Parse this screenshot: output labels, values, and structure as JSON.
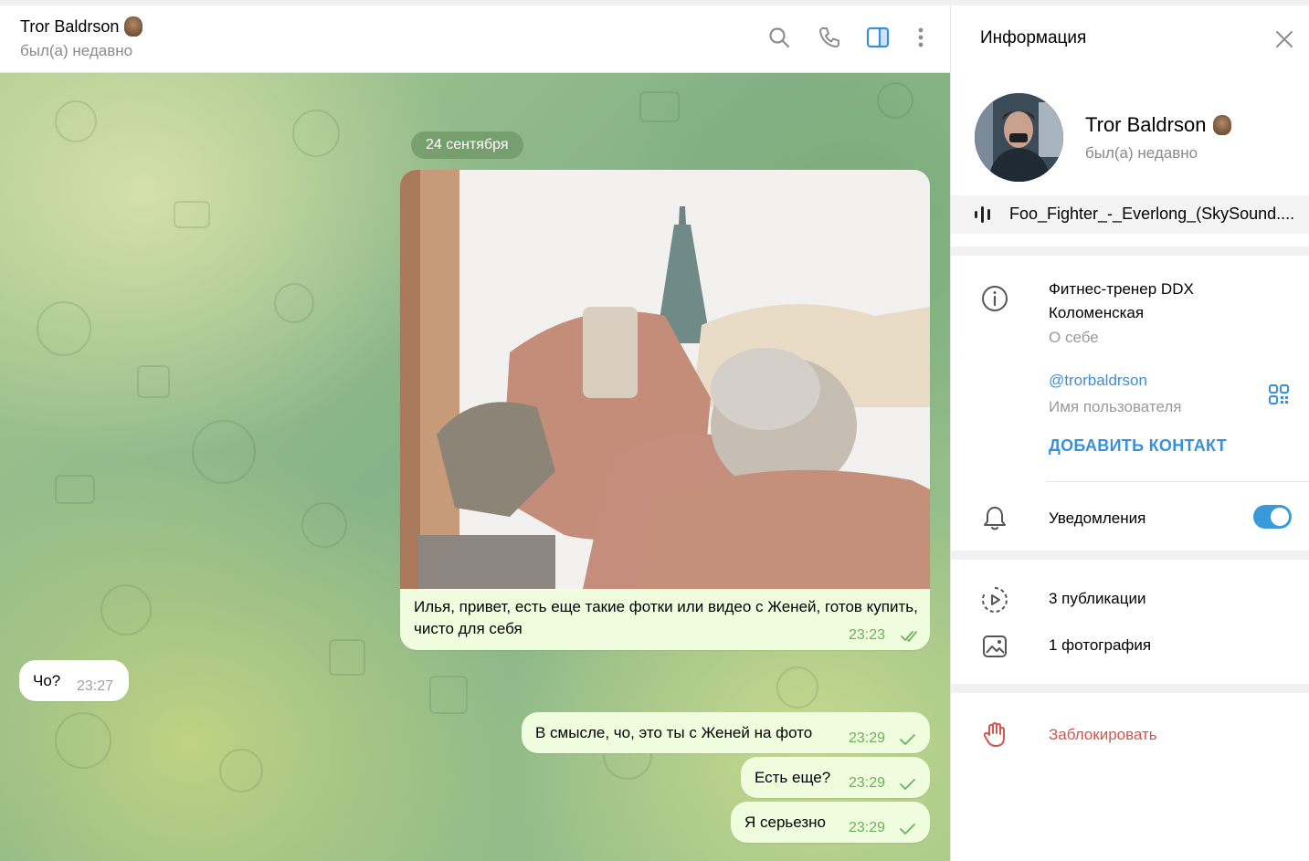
{
  "chat": {
    "title": "Tror Baldrson",
    "status": "был(а) недавно",
    "header_icons": [
      "search-icon",
      "phone-icon",
      "sidebar-toggle-icon",
      "more-vertical-icon"
    ],
    "date_separator": "24 сентября",
    "messages": [
      {
        "type": "photo",
        "direction": "out",
        "caption": "Илья, привет, есть еще такие фотки или видео с Женей, готов купить, чисто для себя",
        "time": "23:23",
        "read": true
      },
      {
        "type": "text",
        "direction": "in",
        "text": "Чо?",
        "time": "23:27"
      },
      {
        "type": "text",
        "direction": "out",
        "text": "В смысле, чо, это ты с Женей на фото",
        "time": "23:29",
        "read": false
      },
      {
        "type": "text",
        "direction": "out",
        "text": "Есть еще?",
        "time": "23:29",
        "read": false
      },
      {
        "type": "text",
        "direction": "out",
        "text": "Я серьезно",
        "time": "23:29",
        "read": false
      }
    ]
  },
  "info": {
    "title": "Информация",
    "name": "Tror Baldrson",
    "status": "был(а) недавно",
    "music": "Foo_Fighter_-_Everlong_(SkySound....",
    "bio": "Фитнес-тренер DDX Коломенская",
    "bio_label": "О себе",
    "username": "@trorbaldrson",
    "username_label": "Имя пользователя",
    "add_contact": "ДОБАВИТЬ КОНТАКТ",
    "notifications": "Уведомления",
    "notifications_on": true,
    "posts": "3 публикации",
    "photos": "1 фотография",
    "block": "Заблокировать"
  },
  "colors": {
    "accent": "#3a90d8",
    "outgoing_bubble": "#effdde",
    "incoming_bubble": "#ffffff",
    "time_out": "#6bb05a",
    "danger": "#d9534f"
  }
}
